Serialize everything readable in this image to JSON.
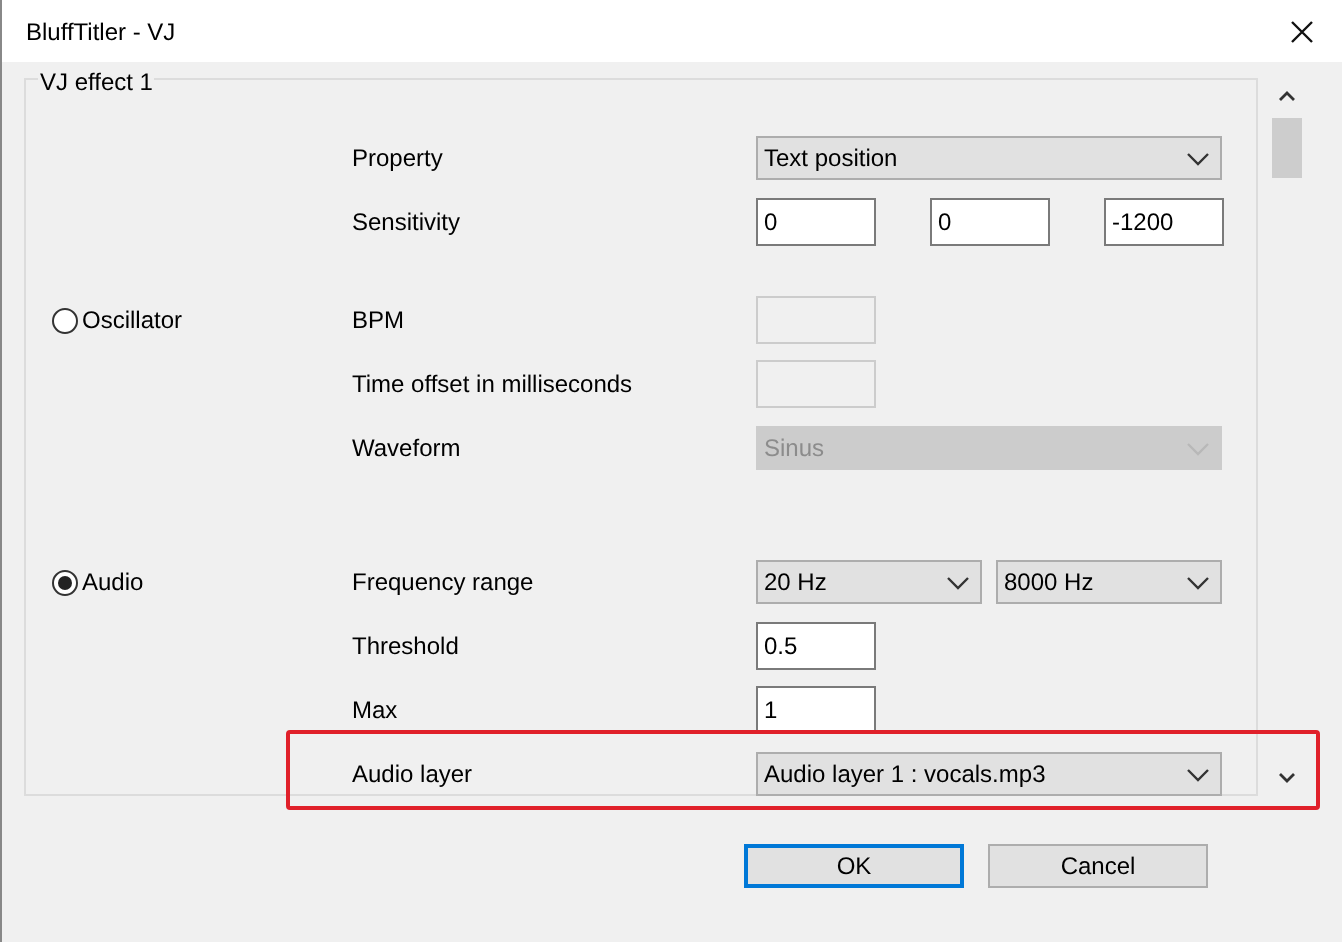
{
  "window": {
    "title": "BluffTitler - VJ"
  },
  "group": {
    "title": "VJ effect 1"
  },
  "sections": [
    {
      "rows": [
        {
          "label": "Property",
          "controls": [
            {
              "kind": "select",
              "value": "Text position",
              "disabled": false
            }
          ]
        },
        {
          "label": "Sensitivity",
          "controls": [
            {
              "kind": "input",
              "value": "0",
              "disabled": false
            },
            {
              "kind": "input",
              "value": "0",
              "disabled": false
            },
            {
              "kind": "input",
              "value": "-1200",
              "disabled": false
            }
          ]
        }
      ]
    },
    {
      "radio": {
        "label": "Oscillator",
        "selected": false
      },
      "rows": [
        {
          "label": "BPM",
          "controls": [
            {
              "kind": "input",
              "disabled": true
            }
          ]
        },
        {
          "label": "Time offset in milliseconds",
          "controls": [
            {
              "kind": "input",
              "disabled": true
            }
          ]
        },
        {
          "label": "Waveform",
          "controls": [
            {
              "kind": "select",
              "value": "Sinus",
              "disabled": true
            }
          ]
        }
      ]
    },
    {
      "radio": {
        "label": "Audio",
        "selected": true
      },
      "rows": [
        {
          "label": "Frequency range",
          "controls": [
            {
              "kind": "select",
              "value": "20 Hz",
              "disabled": false
            },
            {
              "kind": "select",
              "value": "8000 Hz",
              "disabled": false
            }
          ]
        },
        {
          "label": "Threshold",
          "controls": [
            {
              "kind": "input",
              "value": "0.5",
              "disabled": false
            }
          ]
        },
        {
          "label": "Max",
          "controls": [
            {
              "kind": "input",
              "value": "1",
              "disabled": false
            }
          ]
        },
        {
          "label": "Audio layer",
          "highlighted": true,
          "controls": [
            {
              "kind": "select",
              "value": "Audio layer 1 : vocals.mp3",
              "disabled": false
            }
          ]
        }
      ]
    }
  ],
  "buttons": [
    {
      "label": "OK",
      "default": true
    },
    {
      "label": "Cancel",
      "default": false
    }
  ]
}
